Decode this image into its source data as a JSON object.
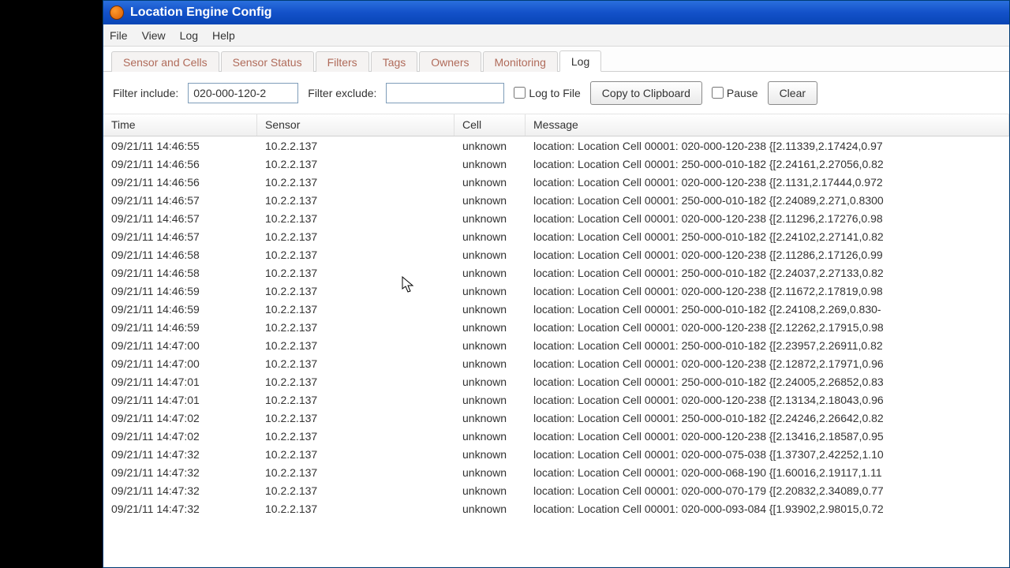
{
  "window": {
    "title": "Location Engine Config"
  },
  "menu": {
    "file": "File",
    "view": "View",
    "log": "Log",
    "help": "Help"
  },
  "tabs": {
    "sensor_cells": "Sensor and Cells",
    "sensor_status": "Sensor Status",
    "filters": "Filters",
    "tags": "Tags",
    "owners": "Owners",
    "monitoring": "Monitoring",
    "log": "Log"
  },
  "filter": {
    "include_label": "Filter include:",
    "include_value": "020-000-120-2",
    "exclude_label": "Filter exclude:",
    "exclude_value": "",
    "log_to_file": "Log to File",
    "copy": "Copy to Clipboard",
    "pause": "Pause",
    "clear": "Clear"
  },
  "columns": {
    "time": "Time",
    "sensor": "Sensor",
    "cell": "Cell",
    "message": "Message"
  },
  "rows": [
    {
      "time": "09/21/11 14:46:55",
      "sensor": "10.2.2.137",
      "cell": "unknown",
      "message": "location: Location Cell 00001: 020-000-120-238 {[2.11339,2.17424,0.97"
    },
    {
      "time": "09/21/11 14:46:56",
      "sensor": "10.2.2.137",
      "cell": "unknown",
      "message": "location: Location Cell 00001: 250-000-010-182 {[2.24161,2.27056,0.82"
    },
    {
      "time": "09/21/11 14:46:56",
      "sensor": "10.2.2.137",
      "cell": "unknown",
      "message": "location: Location Cell 00001: 020-000-120-238 {[2.1131,2.17444,0.972"
    },
    {
      "time": "09/21/11 14:46:57",
      "sensor": "10.2.2.137",
      "cell": "unknown",
      "message": "location: Location Cell 00001: 250-000-010-182 {[2.24089,2.271,0.8300"
    },
    {
      "time": "09/21/11 14:46:57",
      "sensor": "10.2.2.137",
      "cell": "unknown",
      "message": "location: Location Cell 00001: 020-000-120-238 {[2.11296,2.17276,0.98"
    },
    {
      "time": "09/21/11 14:46:57",
      "sensor": "10.2.2.137",
      "cell": "unknown",
      "message": "location: Location Cell 00001: 250-000-010-182 {[2.24102,2.27141,0.82"
    },
    {
      "time": "09/21/11 14:46:58",
      "sensor": "10.2.2.137",
      "cell": "unknown",
      "message": "location: Location Cell 00001: 020-000-120-238 {[2.11286,2.17126,0.99"
    },
    {
      "time": "09/21/11 14:46:58",
      "sensor": "10.2.2.137",
      "cell": "unknown",
      "message": "location: Location Cell 00001: 250-000-010-182 {[2.24037,2.27133,0.82"
    },
    {
      "time": "09/21/11 14:46:59",
      "sensor": "10.2.2.137",
      "cell": "unknown",
      "message": "location: Location Cell 00001: 020-000-120-238 {[2.11672,2.17819,0.98"
    },
    {
      "time": "09/21/11 14:46:59",
      "sensor": "10.2.2.137",
      "cell": "unknown",
      "message": "location: Location Cell 00001: 250-000-010-182 {[2.24108,2.269,0.830-"
    },
    {
      "time": "09/21/11 14:46:59",
      "sensor": "10.2.2.137",
      "cell": "unknown",
      "message": "location: Location Cell 00001: 020-000-120-238 {[2.12262,2.17915,0.98"
    },
    {
      "time": "09/21/11 14:47:00",
      "sensor": "10.2.2.137",
      "cell": "unknown",
      "message": "location: Location Cell 00001: 250-000-010-182 {[2.23957,2.26911,0.82"
    },
    {
      "time": "09/21/11 14:47:00",
      "sensor": "10.2.2.137",
      "cell": "unknown",
      "message": "location: Location Cell 00001: 020-000-120-238 {[2.12872,2.17971,0.96"
    },
    {
      "time": "09/21/11 14:47:01",
      "sensor": "10.2.2.137",
      "cell": "unknown",
      "message": "location: Location Cell 00001: 250-000-010-182 {[2.24005,2.26852,0.83"
    },
    {
      "time": "09/21/11 14:47:01",
      "sensor": "10.2.2.137",
      "cell": "unknown",
      "message": "location: Location Cell 00001: 020-000-120-238 {[2.13134,2.18043,0.96"
    },
    {
      "time": "09/21/11 14:47:02",
      "sensor": "10.2.2.137",
      "cell": "unknown",
      "message": "location: Location Cell 00001: 250-000-010-182 {[2.24246,2.26642,0.82"
    },
    {
      "time": "09/21/11 14:47:02",
      "sensor": "10.2.2.137",
      "cell": "unknown",
      "message": "location: Location Cell 00001: 020-000-120-238 {[2.13416,2.18587,0.95"
    },
    {
      "time": "09/21/11 14:47:32",
      "sensor": "10.2.2.137",
      "cell": "unknown",
      "message": "location: Location Cell 00001: 020-000-075-038 {[1.37307,2.42252,1.10"
    },
    {
      "time": "09/21/11 14:47:32",
      "sensor": "10.2.2.137",
      "cell": "unknown",
      "message": "location: Location Cell 00001: 020-000-068-190 {[1.60016,2.19117,1.11"
    },
    {
      "time": "09/21/11 14:47:32",
      "sensor": "10.2.2.137",
      "cell": "unknown",
      "message": "location: Location Cell 00001: 020-000-070-179 {[2.20832,2.34089,0.77"
    },
    {
      "time": "09/21/11 14:47:32",
      "sensor": "10.2.2.137",
      "cell": "unknown",
      "message": "location: Location Cell 00001: 020-000-093-084 {[1.93902,2.98015,0.72"
    }
  ]
}
